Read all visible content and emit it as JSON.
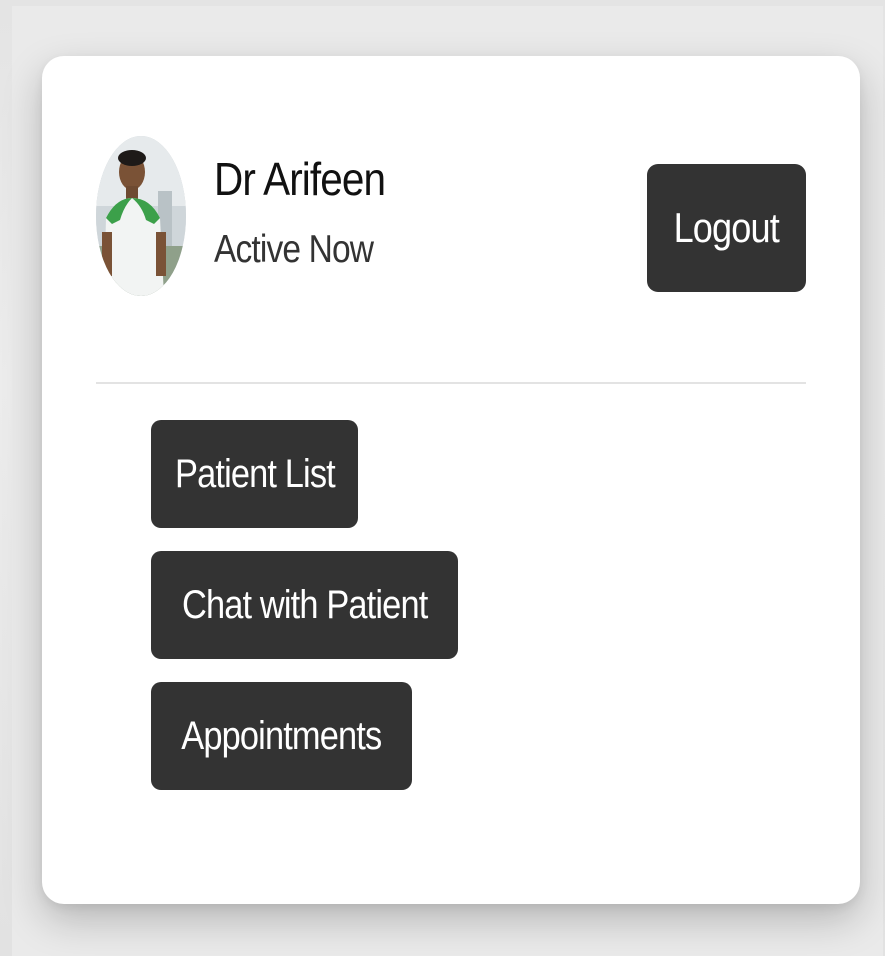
{
  "profile": {
    "name": "Dr Arifeen",
    "status": "Active Now"
  },
  "header": {
    "logout_label": "Logout"
  },
  "menu": {
    "items": [
      {
        "label": "Patient List"
      },
      {
        "label": "Chat with Patient"
      },
      {
        "label": "Appointments"
      }
    ]
  },
  "colors": {
    "button_bg": "#333333",
    "button_text": "#ffffff",
    "card_bg": "#ffffff",
    "page_bg": "#e6e6e6"
  }
}
